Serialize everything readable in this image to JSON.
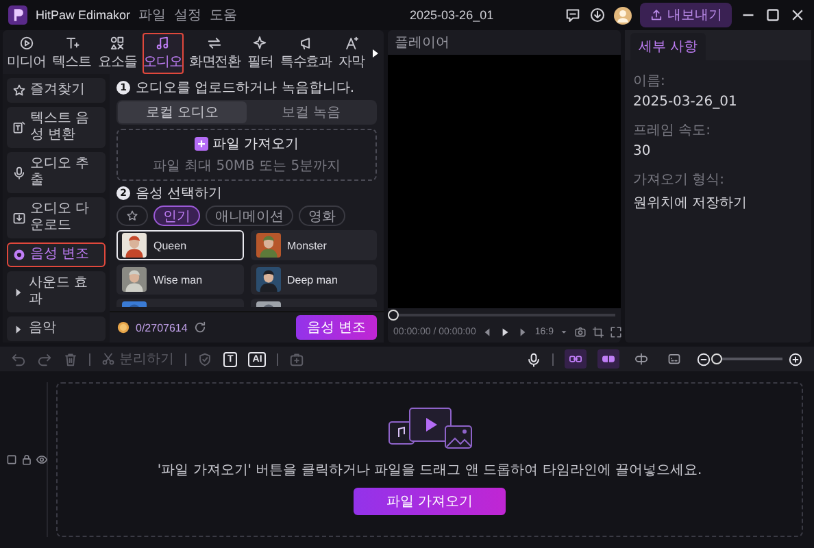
{
  "titlebar": {
    "app_name": "HitPaw Edimakor",
    "menu": [
      "파일",
      "설정",
      "도움"
    ],
    "project": "2025-03-26_01",
    "export_button": "내보내기"
  },
  "tabs": [
    {
      "label": "미디어",
      "kind": "media",
      "selected": false
    },
    {
      "label": "텍스트",
      "kind": "text",
      "selected": false
    },
    {
      "label": "요소들",
      "kind": "elements",
      "selected": false
    },
    {
      "label": "오디오",
      "kind": "audio",
      "selected": true
    },
    {
      "label": "화면전환",
      "kind": "transition",
      "selected": false
    },
    {
      "label": "필터",
      "kind": "filter",
      "selected": false
    },
    {
      "label": "특수효과",
      "kind": "effects",
      "selected": false
    },
    {
      "label": "자막",
      "kind": "subtitle",
      "selected": false
    }
  ],
  "sidebar": [
    {
      "label": "즐겨찾기",
      "kind": "star",
      "selected": false
    },
    {
      "label": "텍스트 음성 변환",
      "kind": "tts",
      "selected": false
    },
    {
      "label": "오디오 추출",
      "kind": "mic",
      "selected": false
    },
    {
      "label": "오디오 다운로드",
      "kind": "download",
      "selected": false
    },
    {
      "label": "음성 변조",
      "kind": "voice",
      "selected": true
    },
    {
      "label": "사운드 효과",
      "kind": "group",
      "selected": false
    },
    {
      "label": "음악",
      "kind": "group",
      "selected": false
    }
  ],
  "voice_changer": {
    "step1": {
      "number": "1",
      "text": "오디오를 업로드하거나 녹음합니다."
    },
    "modes": [
      {
        "label": "로컬 오디오",
        "selected": true
      },
      {
        "label": "보컬 녹음",
        "selected": false
      }
    ],
    "upload": {
      "button": "파일 가져오기",
      "hint": "파일 최대 50MB 또는 5분까지"
    },
    "step2": {
      "number": "2",
      "text": "음성 선택하기"
    },
    "filters": [
      {
        "kind": "favorite",
        "selected": false
      },
      {
        "kind": "label",
        "label": "인기",
        "selected": true
      },
      {
        "kind": "label",
        "label": "애니메이션",
        "selected": false
      },
      {
        "kind": "label",
        "label": "영화",
        "selected": false
      }
    ],
    "voices": [
      {
        "name": "Queen",
        "selected": true
      },
      {
        "name": "Monster",
        "selected": false
      },
      {
        "name": "Wise man",
        "selected": false
      },
      {
        "name": "Deep man",
        "selected": false
      },
      {
        "selected": false
      },
      {
        "selected": false
      }
    ],
    "credits": "0/2707614",
    "apply_button": "음성 변조"
  },
  "player": {
    "title": "플레이어",
    "playhead": {
      "level": 0
    },
    "time": "00:00:00 / 00:00:00",
    "ratio": "16:9"
  },
  "details": {
    "tab": "세부 사항",
    "fields": [
      {
        "label": "이름:",
        "value": "2025-03-26_01"
      },
      {
        "label": "프레임 속도:",
        "value": "30"
      },
      {
        "label": "가져오기 형식:",
        "value": "원위치에 저장하기"
      }
    ]
  },
  "toolbar": {
    "tools": [
      {
        "kind": "undo",
        "disabled": true
      },
      {
        "kind": "redo",
        "disabled": true
      },
      {
        "kind": "delete",
        "disabled": true
      },
      {
        "kind": "divider"
      },
      {
        "kind": "split",
        "label": "분리하기",
        "disabled": true
      },
      {
        "kind": "divider"
      },
      {
        "kind": "shield",
        "disabled": true
      },
      {
        "kind": "text",
        "label": "T",
        "disabled": false
      },
      {
        "kind": "ai",
        "label": "AI",
        "disabled": false
      },
      {
        "kind": "divider"
      },
      {
        "kind": "freeze",
        "disabled": true
      }
    ],
    "toggles": [
      {
        "kind": "link",
        "on": true
      },
      {
        "kind": "snap",
        "on": true
      },
      {
        "kind": "split",
        "on": false
      },
      {
        "kind": "caption",
        "on": false
      }
    ],
    "zoom": {
      "level": 0
    }
  },
  "timeline": {
    "hint": "'파일 가져오기' 버튼을 클릭하거나 파일을 드래그 앤 드롭하여 타임라인에 끌어넣으세요.",
    "button": "파일 가져오기"
  }
}
